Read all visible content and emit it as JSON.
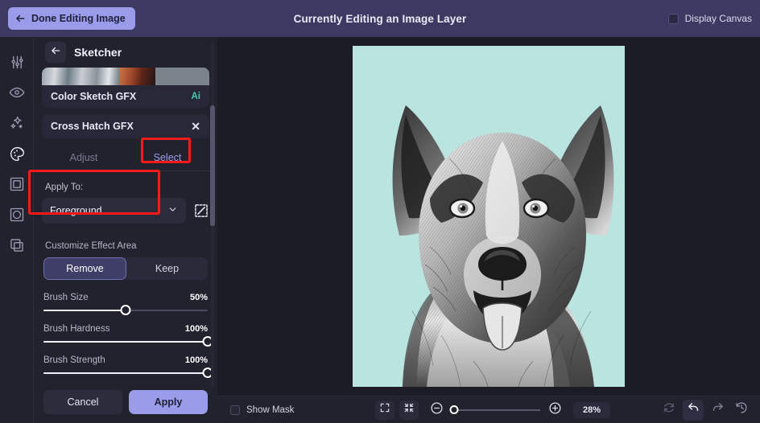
{
  "topbar": {
    "done_button": "Done Editing Image",
    "back_arrow_icon": "arrow-left-icon",
    "title": "Currently Editing an Image Layer",
    "display_canvas_label": "Display Canvas",
    "display_canvas_checked": false
  },
  "rail": {
    "items": [
      {
        "name": "adjust-sliders-icon",
        "label": "Adjust"
      },
      {
        "name": "eye-icon",
        "label": "Preview"
      },
      {
        "name": "sparkles-icon",
        "label": "Effects"
      },
      {
        "name": "palette-icon",
        "label": "Sketcher",
        "active": true
      },
      {
        "name": "frame-icon",
        "label": "Frame"
      },
      {
        "name": "crop-shape-icon",
        "label": "Shape"
      },
      {
        "name": "layers-icon",
        "label": "Layers"
      }
    ]
  },
  "panel": {
    "back_icon": "arrow-left-icon",
    "title": "Sketcher",
    "preset_card": {
      "name": "Color Sketch GFX",
      "badge": "Ai"
    },
    "effect_card": {
      "name": "Cross Hatch GFX",
      "close_icon": "close-icon"
    },
    "tabs": [
      {
        "label": "Adjust",
        "active": false
      },
      {
        "label": "Select",
        "active": true
      }
    ],
    "apply_to": {
      "label": "Apply To:",
      "value": "Foreground",
      "chevron_icon": "chevron-down-icon",
      "selection_icon": "selection-mask-icon"
    },
    "customize": {
      "label": "Customize Effect Area",
      "options": [
        {
          "label": "Remove",
          "active": true
        },
        {
          "label": "Keep",
          "active": false
        }
      ]
    },
    "sliders": [
      {
        "label": "Brush Size",
        "value": "50%",
        "percent": 50
      },
      {
        "label": "Brush Hardness",
        "value": "100%",
        "percent": 100
      },
      {
        "label": "Brush Strength",
        "value": "100%",
        "percent": 100
      }
    ],
    "actions": {
      "cancel": "Cancel",
      "apply": "Apply"
    }
  },
  "canvas": {
    "background_color": "#b9e4e0",
    "subject": "German Shepherd pencil sketch portrait"
  },
  "bottombar": {
    "show_mask_label": "Show Mask",
    "show_mask_checked": false,
    "fit_screen_icon": "expand-frame-icon",
    "fit_content_icon": "collapse-frame-icon",
    "zoom_out_icon": "minus-circle-icon",
    "zoom_in_icon": "plus-circle-icon",
    "zoom_level": "28%",
    "zoom_percent": 3,
    "reset_icon": "reset-icon",
    "undo_icon": "undo-icon",
    "redo_icon": "redo-icon",
    "history_icon": "history-icon"
  },
  "colors": {
    "accent": "#9a9ce9",
    "topbar": "#3c3a62",
    "panel": "#22222f",
    "stage": "#1c1c27",
    "highlight_box": "#ff1a1a",
    "ai_badge": "#3fcdb4"
  }
}
